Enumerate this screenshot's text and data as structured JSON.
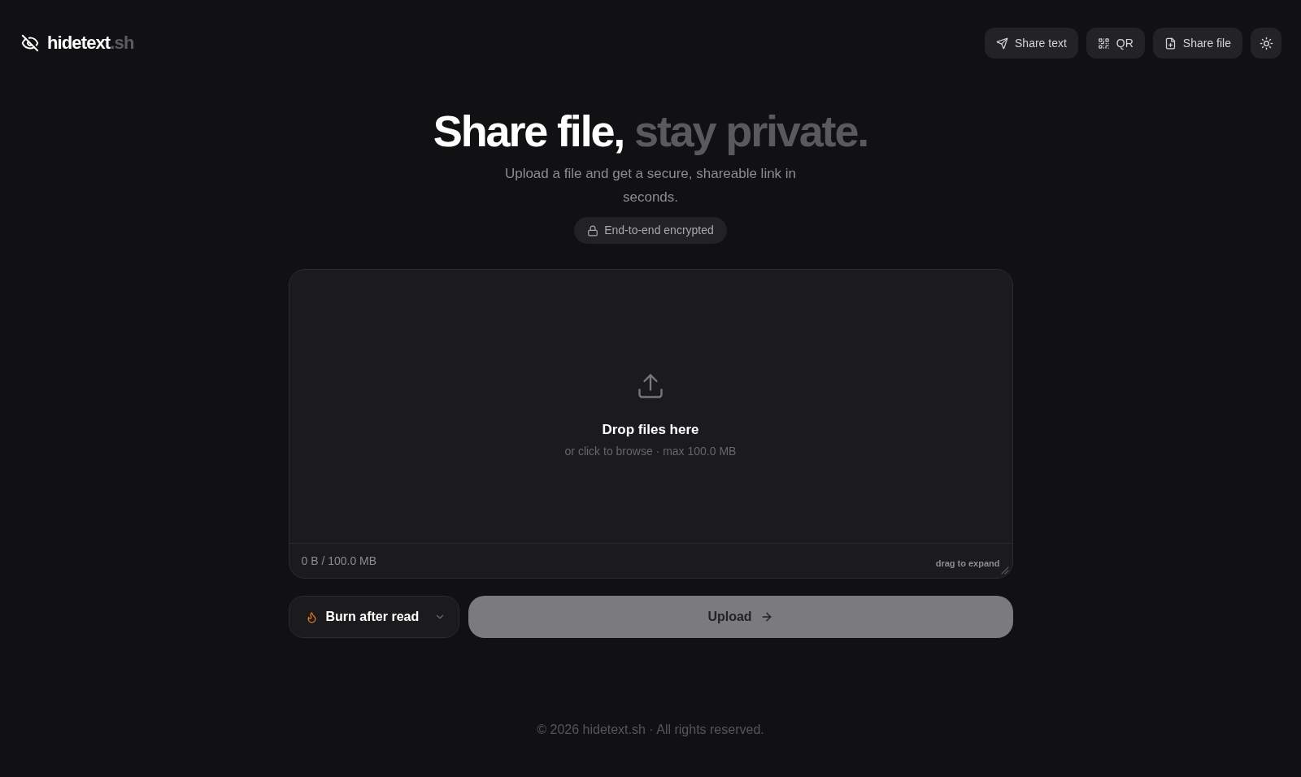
{
  "header": {
    "logo": {
      "name": "hidetext",
      "suffix": ".sh"
    },
    "nav": [
      {
        "kind": "send",
        "label": "Share text"
      },
      {
        "kind": "qr",
        "label": "QR"
      },
      {
        "kind": "file",
        "label": "Share file"
      }
    ]
  },
  "hero": {
    "title": "Share file,",
    "title_accent": "stay private.",
    "subtitle": "Upload a file and get a secure, shareable link in seconds.",
    "badge": "End-to-end encrypted"
  },
  "dropzone": {
    "title": "Drop files here",
    "hint": "or click to browse · max 100.0 MB",
    "usage": "0 B / 100.0 MB",
    "resize_hint": "drag to expand"
  },
  "actions": {
    "expiry": {
      "label": "Burn after read"
    },
    "upload": {
      "label": "Upload",
      "disabled": true
    }
  },
  "footer": {
    "text": "© 2026 hidetext.sh · All rights reserved."
  }
}
